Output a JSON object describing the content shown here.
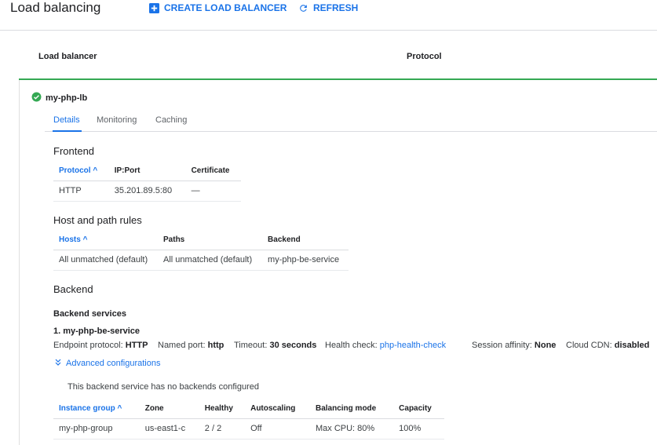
{
  "header": {
    "title": "Load balancing",
    "create_label": "CREATE LOAD BALANCER",
    "refresh_label": "REFRESH"
  },
  "list_header": {
    "col_load_balancer": "Load balancer",
    "col_protocol": "Protocol"
  },
  "lb": {
    "name": "my-php-lb",
    "status_color": "#34a853"
  },
  "tabs": [
    "Details",
    "Monitoring",
    "Caching"
  ],
  "frontend": {
    "title": "Frontend",
    "columns": [
      "Protocol",
      "IP:Port",
      "Certificate"
    ],
    "sort_arrow": "^",
    "rows": [
      [
        "HTTP",
        "35.201.89.5:80",
        "—"
      ]
    ]
  },
  "host_rules": {
    "title": "Host and path rules",
    "columns": [
      "Hosts",
      "Paths",
      "Backend"
    ],
    "sort_arrow": "^",
    "rows": [
      [
        "All unmatched (default)",
        "All unmatched (default)",
        "my-php-be-service"
      ]
    ]
  },
  "backend": {
    "title": "Backend",
    "services_title": "Backend services",
    "service_name": "1. my-php-be-service",
    "endpoint_label": "Endpoint protocol:",
    "endpoint_value": "HTTP",
    "named_port_label": "Named port:",
    "named_port_value": "http",
    "timeout_label": "Timeout:",
    "timeout_value": "30 seconds",
    "health_label": "Health check:",
    "health_value": "php-health-check",
    "affinity_label": "Session affinity:",
    "affinity_value": "None",
    "cdn_label": "Cloud CDN:",
    "cdn_value": "disabled",
    "advanced_label": "Advanced configurations",
    "no_backends_msg": "This backend service has no backends configured",
    "columns": [
      "Instance group",
      "Zone",
      "Healthy",
      "Autoscaling",
      "Balancing mode",
      "Capacity"
    ],
    "sort_arrow": "^",
    "rows": [
      [
        "my-php-group",
        "us-east1-c",
        "2 / 2",
        "Off",
        "Max CPU: 80%",
        "100%"
      ]
    ]
  },
  "colors": {
    "accent": "#1a73e8",
    "success": "#34a853"
  }
}
